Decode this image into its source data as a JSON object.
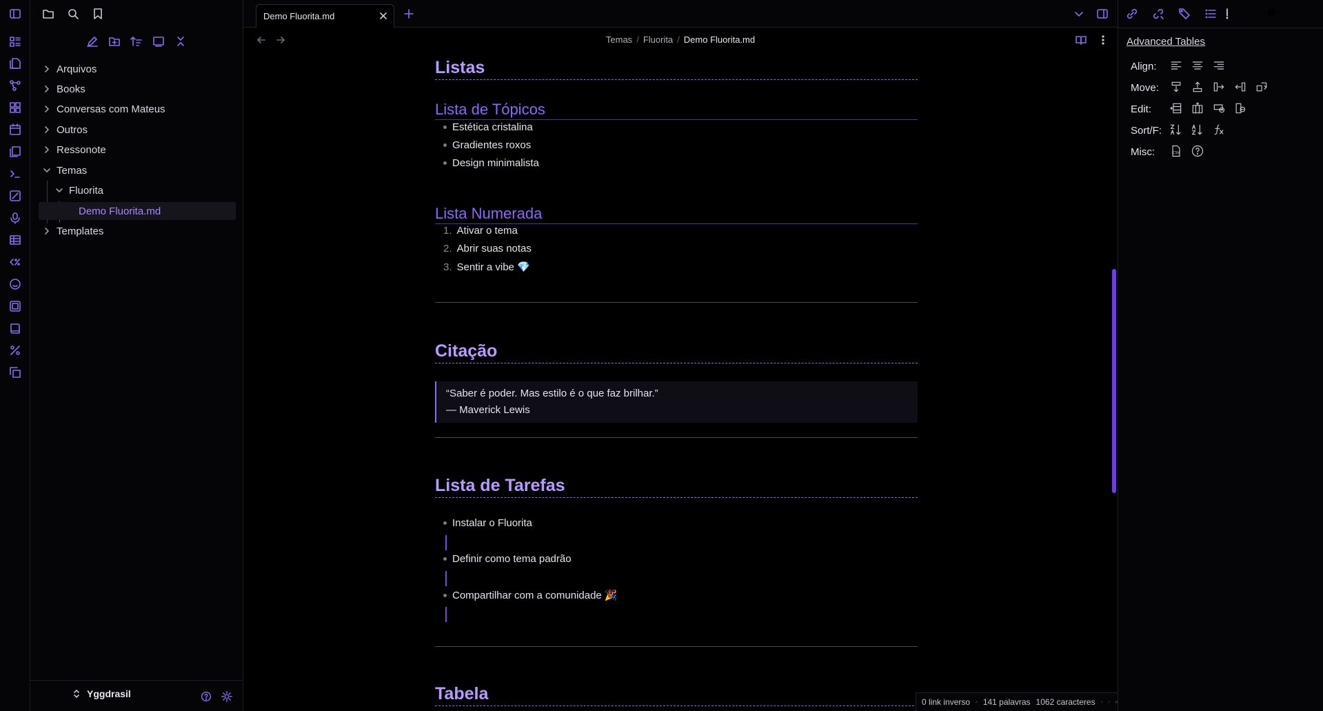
{
  "tab": {
    "title": "Demo Fluorita.md"
  },
  "breadcrumb": [
    "Temas",
    "Fluorita",
    "Demo Fluorita.md"
  ],
  "explorer": {
    "items": [
      {
        "label": "Arquivos",
        "expanded": false
      },
      {
        "label": "Books",
        "expanded": false
      },
      {
        "label": "Conversas com Mateus",
        "expanded": false
      },
      {
        "label": "Outros",
        "expanded": false
      },
      {
        "label": "Ressonote",
        "expanded": false
      },
      {
        "label": "Temas",
        "expanded": true
      },
      {
        "label": "Fluorita",
        "expanded": true
      },
      {
        "label": "Demo Fluorita.md",
        "active": true
      },
      {
        "label": "Templates",
        "expanded": false
      }
    ],
    "vault_name": "Yggdrasil"
  },
  "document": {
    "listas": {
      "heading": "Listas",
      "topicos": {
        "heading": "Lista de Tópicos",
        "items": [
          "Estética cristalina",
          "Gradientes roxos",
          "Design minimalista"
        ]
      },
      "numerada": {
        "heading": "Lista Numerada",
        "items": [
          {
            "num": "1.",
            "text": "Ativar o tema"
          },
          {
            "num": "2.",
            "text": "Abrir suas notas"
          },
          {
            "num": "3.",
            "text": "Sentir a vibe 💎"
          }
        ]
      }
    },
    "citacao": {
      "heading": "Citação",
      "quote": "“Saber é poder. Mas estilo é o que faz brilhar.”",
      "author": "— Maverick Lewis"
    },
    "tarefas": {
      "heading": "Lista de Tarefas",
      "items": [
        "Instalar o Fluorita",
        "Definir como tema padrão",
        "Compartilhar com a comunidade 🎉"
      ]
    },
    "tabela": {
      "heading": "Tabela"
    }
  },
  "advanced_tables": {
    "title": "Advanced Tables",
    "rows": [
      "Align:",
      "Move:",
      "Edit:",
      "Sort/F:",
      "Misc:"
    ]
  },
  "status_bar": {
    "backlinks": "0 link inverso",
    "words": "141 palavras",
    "chars": "1062 caracteres"
  },
  "colors": {
    "accent": "#8a6cf0",
    "heading": "#b99bff",
    "subheading": "#8e66ff",
    "background": "#000000"
  }
}
